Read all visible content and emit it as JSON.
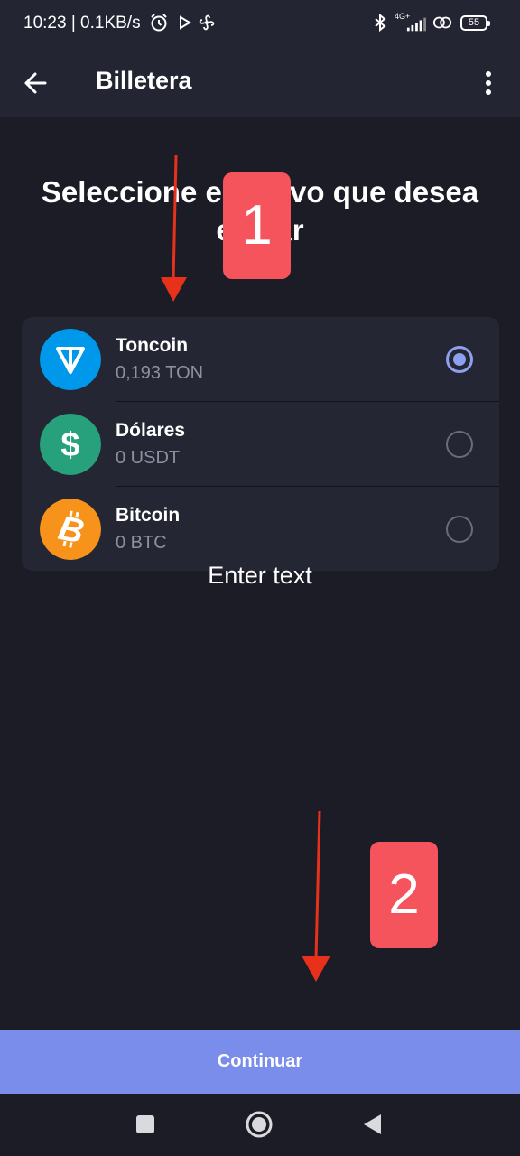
{
  "status_bar": {
    "time": "10:23 | 0.1KB/s",
    "network": "4G+",
    "battery": "55"
  },
  "app_bar": {
    "title": "Billetera"
  },
  "heading": "Seleccione el activo que desea enviar",
  "assets": [
    {
      "name": "Toncoin",
      "balance": "0,193 TON",
      "selected": true,
      "icon": "toncoin-icon",
      "color": "#0098ea"
    },
    {
      "name": "Dólares",
      "balance": "0 USDT",
      "selected": false,
      "icon": "dollar-icon",
      "color": "#26a17b"
    },
    {
      "name": "Bitcoin",
      "balance": "0 BTC",
      "selected": false,
      "icon": "bitcoin-icon",
      "color": "#f7931a"
    }
  ],
  "overlay_text": "Enter text",
  "annotations": {
    "badge_1": "1",
    "badge_2": "2",
    "badge_color": "#f5545d",
    "arrow_color": "#e8311b"
  },
  "continue_label": "Continuar",
  "colors": {
    "background": "#1c1c27",
    "card": "#242634",
    "accent": "#7a8deb",
    "radio": "#8da0ef"
  }
}
